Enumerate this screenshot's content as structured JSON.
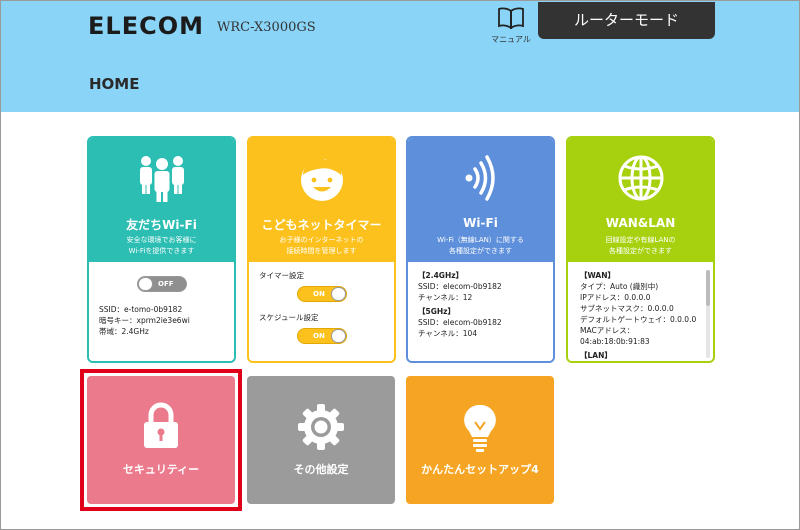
{
  "header": {
    "brand": "ELECOM",
    "model": "WRC-X3000GS",
    "manual_label": "マニュアル",
    "mode_button": "ルーターモード",
    "page_title": "HOME"
  },
  "colors": {
    "header_bg": "#8ad4f7",
    "teal": "#2cbeb2",
    "yellow": "#fcc11d",
    "blue": "#5e8fdb",
    "green": "#a7d10f",
    "pink": "#ec7a8d",
    "gray": "#9b9b9b",
    "orange": "#f5a523",
    "highlight": "#e0001b"
  },
  "cards": {
    "friends_wifi": {
      "title": "友だちWi-Fi",
      "subtitle_line1": "安全な環境でお客様に",
      "subtitle_line2": "Wi-Fiを提供できます",
      "toggle_label": "OFF",
      "ssid": "SSID：e-tomo-0b9182",
      "password": "暗号キー：xprm2ie3e6wi",
      "band": "帯域：2.4GHz",
      "icon": "people-icon"
    },
    "kids_timer": {
      "title": "こどもネットタイマー",
      "subtitle_line1": "お子様のインターネットの",
      "subtitle_line2": "接続時間を管理します",
      "timer_label": "タイマー設定",
      "timer_toggle": "ON",
      "schedule_label": "スケジュール設定",
      "schedule_toggle": "ON",
      "icon": "child-face-icon"
    },
    "wifi": {
      "title": "Wi-Fi",
      "subtitle_line1": "Wi-Fi（無線LAN）に関する",
      "subtitle_line2": "各種設定ができます",
      "band24_heading": "【2.4GHz】",
      "band24_ssid": "SSID：elecom-0b9182",
      "band24_channel": "チャンネル：12",
      "band5_heading": "【5GHz】",
      "band5_ssid": "SSID：elecom-0b9182",
      "band5_channel": "チャンネル：104",
      "icon": "wifi-signal-icon"
    },
    "wan_lan": {
      "title": "WAN&LAN",
      "subtitle_line1": "回線設定や有線LANの",
      "subtitle_line2": "各種設定ができます",
      "wan_heading": "【WAN】",
      "type": "タイプ：Auto (識別中)",
      "ip": "IPアドレス：0.0.0.0",
      "subnet": "サブネットマスク：0.0.0.0",
      "gateway": "デフォルトゲートウェイ：0.0.0.0",
      "mac_label": "MACアドレス：",
      "mac_value": "04:ab:18:0b:91:83",
      "lan_heading": "【LAN】",
      "icon": "globe-icon"
    }
  },
  "tiles": {
    "security": {
      "label": "セキュリティー",
      "icon": "lock-icon"
    },
    "other_settings": {
      "label": "その他設定",
      "icon": "gear-icon"
    },
    "easy_setup": {
      "label": "かんたんセットアップ4",
      "icon": "lightbulb-icon"
    }
  }
}
